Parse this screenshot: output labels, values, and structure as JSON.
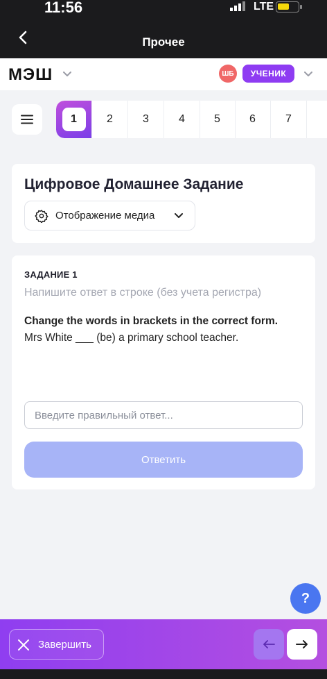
{
  "status_bar": {
    "time": "11:56",
    "network": "LTE"
  },
  "nav": {
    "title": "Прочее"
  },
  "app_bar": {
    "logo": "МЭШ",
    "avatar_initials": "ШБ",
    "role": "УЧЕНИК"
  },
  "question_nav": {
    "items": [
      "1",
      "2",
      "3",
      "4",
      "5",
      "6",
      "7"
    ],
    "active": "1"
  },
  "header_card": {
    "title": "Цифровое Домашнее Задание",
    "media_label": "Отображение медиа"
  },
  "task": {
    "title": "ЗАДАНИЕ 1",
    "hint": "Напишите ответ в строке (без учета регистра)",
    "instruction": "Change the words in brackets in the correct form.",
    "sentence": "Mrs White ___ (be) a primary school teacher.",
    "answer_placeholder": "Введите правильный ответ...",
    "answer_value": "",
    "submit_label": "Ответить"
  },
  "help": {
    "label": "?"
  },
  "bottom_bar": {
    "finish_label": "Завершить"
  },
  "colors": {
    "accent": "#8e3cf2",
    "submit_disabled": "#a7b4f7",
    "help": "#4a76f0",
    "avatar": "#f06767"
  },
  "icons": [
    "back-chevron-icon",
    "chevron-down-icon",
    "menu-icon",
    "gear-icon",
    "close-icon",
    "arrow-left-icon",
    "arrow-right-icon",
    "battery-icon",
    "signal-icon"
  ]
}
